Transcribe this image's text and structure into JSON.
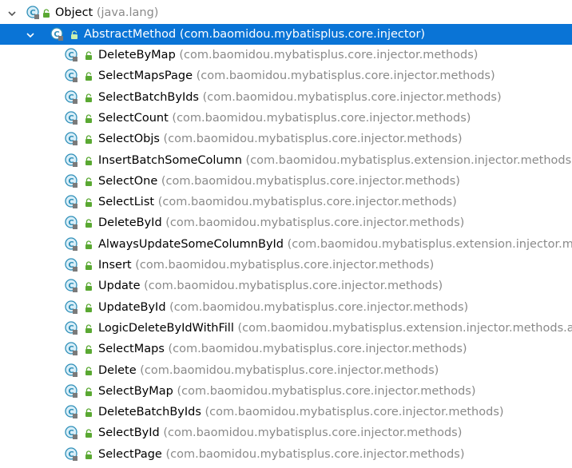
{
  "tree": {
    "root": {
      "name": "Object",
      "package": "(java.lang)",
      "expanded": true
    },
    "parent": {
      "name": "AbstractMethod",
      "package": "(com.baomidou.mybatisplus.core.injector)",
      "expanded": true,
      "selected": true
    },
    "children": [
      {
        "name": "DeleteByMap",
        "package": "(com.baomidou.mybatisplus.core.injector.methods)"
      },
      {
        "name": "SelectMapsPage",
        "package": "(com.baomidou.mybatisplus.core.injector.methods)"
      },
      {
        "name": "SelectBatchByIds",
        "package": "(com.baomidou.mybatisplus.core.injector.methods)"
      },
      {
        "name": "SelectCount",
        "package": "(com.baomidou.mybatisplus.core.injector.methods)"
      },
      {
        "name": "SelectObjs",
        "package": "(com.baomidou.mybatisplus.core.injector.methods)"
      },
      {
        "name": "InsertBatchSomeColumn",
        "package": "(com.baomidou.mybatisplus.extension.injector.methods.a"
      },
      {
        "name": "SelectOne",
        "package": "(com.baomidou.mybatisplus.core.injector.methods)"
      },
      {
        "name": "SelectList",
        "package": "(com.baomidou.mybatisplus.core.injector.methods)"
      },
      {
        "name": "DeleteById",
        "package": "(com.baomidou.mybatisplus.core.injector.methods)"
      },
      {
        "name": "AlwaysUpdateSomeColumnById",
        "package": "(com.baomidou.mybatisplus.extension.injector.me"
      },
      {
        "name": "Insert",
        "package": "(com.baomidou.mybatisplus.core.injector.methods)"
      },
      {
        "name": "Update",
        "package": "(com.baomidou.mybatisplus.core.injector.methods)"
      },
      {
        "name": "UpdateById",
        "package": "(com.baomidou.mybatisplus.core.injector.methods)"
      },
      {
        "name": "LogicDeleteByIdWithFill",
        "package": "(com.baomidou.mybatisplus.extension.injector.methods.ac"
      },
      {
        "name": "SelectMaps",
        "package": "(com.baomidou.mybatisplus.core.injector.methods)"
      },
      {
        "name": "Delete",
        "package": "(com.baomidou.mybatisplus.core.injector.methods)"
      },
      {
        "name": "SelectByMap",
        "package": "(com.baomidou.mybatisplus.core.injector.methods)"
      },
      {
        "name": "DeleteBatchByIds",
        "package": "(com.baomidou.mybatisplus.core.injector.methods)"
      },
      {
        "name": "SelectById",
        "package": "(com.baomidou.mybatisplus.core.injector.methods)"
      },
      {
        "name": "SelectPage",
        "package": "(com.baomidou.mybatisplus.core.injector.methods)"
      }
    ]
  },
  "colors": {
    "selection": "#0a74d6",
    "package_text": "#8a8a8a",
    "class_icon": "#2f8fb8",
    "lock_icon": "#5aa832"
  },
  "icons": {
    "class": "class-c-icon",
    "access": "lock-icon",
    "expand": "chevron-down-icon"
  }
}
